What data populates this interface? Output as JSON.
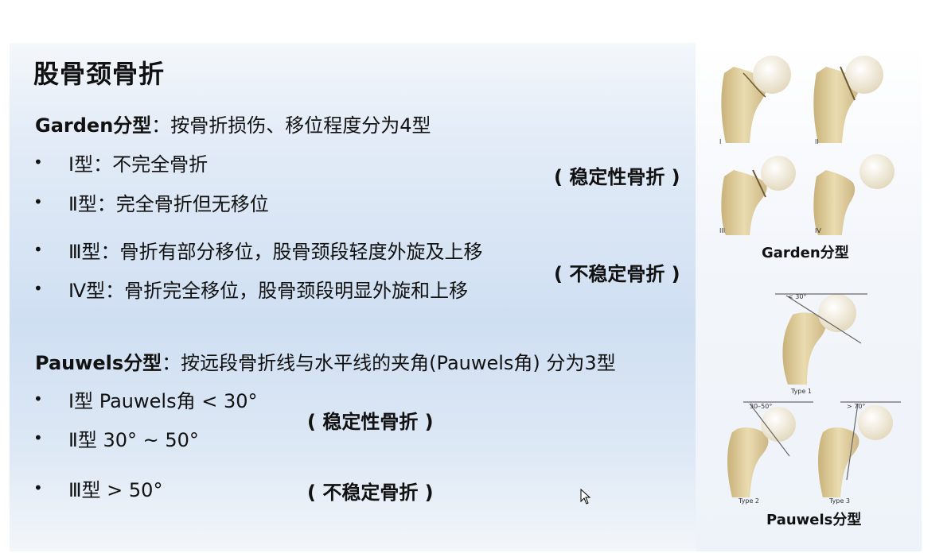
{
  "title": "股骨颈骨折",
  "garden": {
    "label": "Garden分型",
    "desc": "：按骨折损伤、移位程度分为4型",
    "items": [
      "Ⅰ型：不完全骨折",
      "Ⅱ型：完全骨折但无移位",
      "Ⅲ型：骨折有部分移位，股骨颈段轻度外旋及上移",
      "Ⅳ型：骨折完全移位，股骨颈段明显外旋和上移"
    ],
    "stable_note": "( 稳定性骨折 )",
    "unstable_note": "( 不稳定骨折 )"
  },
  "pauwels": {
    "label": "Pauwels分型",
    "desc": "：按远段骨折线与水平线的夹角(Pauwels角) 分为3型",
    "items": [
      "Ⅰ型 Pauwels角 < 30°",
      "Ⅱ型 30° ~ 50°",
      "Ⅲ型 > 50°"
    ],
    "stable_note": "( 稳定性骨折 )",
    "unstable_note": "( 不稳定骨折 )"
  },
  "figures": {
    "garden_caption": "Garden分型",
    "garden_numerals": [
      "I",
      "II",
      "III",
      "IV"
    ],
    "pauwels_caption": "Pauwels分型",
    "pauwels_types": [
      "Type 1",
      "Type 2",
      "Type 3"
    ],
    "pauwels_angles": [
      "< 30°",
      "30–50°",
      "> 70°"
    ]
  },
  "colors": {
    "bone": "#e8d9a8",
    "bone_shadow": "#c9b27a",
    "femoral_head": "#f4efe0",
    "slide_blue": "#cfdff2"
  }
}
